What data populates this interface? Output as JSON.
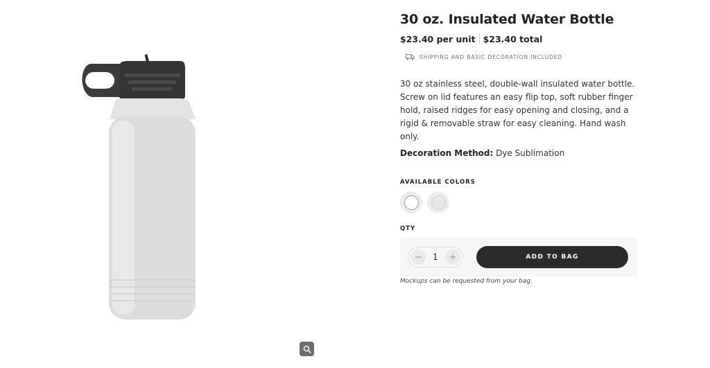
{
  "product": {
    "title": "30 oz. Insulated Water Bottle",
    "unit_price": "$23.40 per unit",
    "total_price": "$23.40 total",
    "shipping_note": "SHIPPING AND BASIC DECORATION INCLUDED",
    "description": "30 oz stainless steel, double-wall insulated water bottle. Screw on lid features an easy flip top, soft rubber finger hold, raised ridges for easy opening and closing, and a rigid & removable straw for easy cleaning. Hand wash only.",
    "decoration_label": "Decoration Method:",
    "decoration_value": "Dye Sublimation"
  },
  "colors": {
    "label": "AVAILABLE COLORS",
    "options": [
      "white-swatch",
      "grey-swatch"
    ]
  },
  "quantity": {
    "label": "QTY",
    "value": "1",
    "minus": "−",
    "plus": "+"
  },
  "cart": {
    "add_label": "ADD TO BAG",
    "note": "Mockups can be requested from your bag."
  },
  "icons": {
    "truck": "truck-icon",
    "zoom": "magnifier-icon"
  },
  "palette": {
    "button_bg": "#2b2b2b",
    "panel_bg": "#f6f6f6",
    "zoom_bg": "#6e6e6e"
  }
}
